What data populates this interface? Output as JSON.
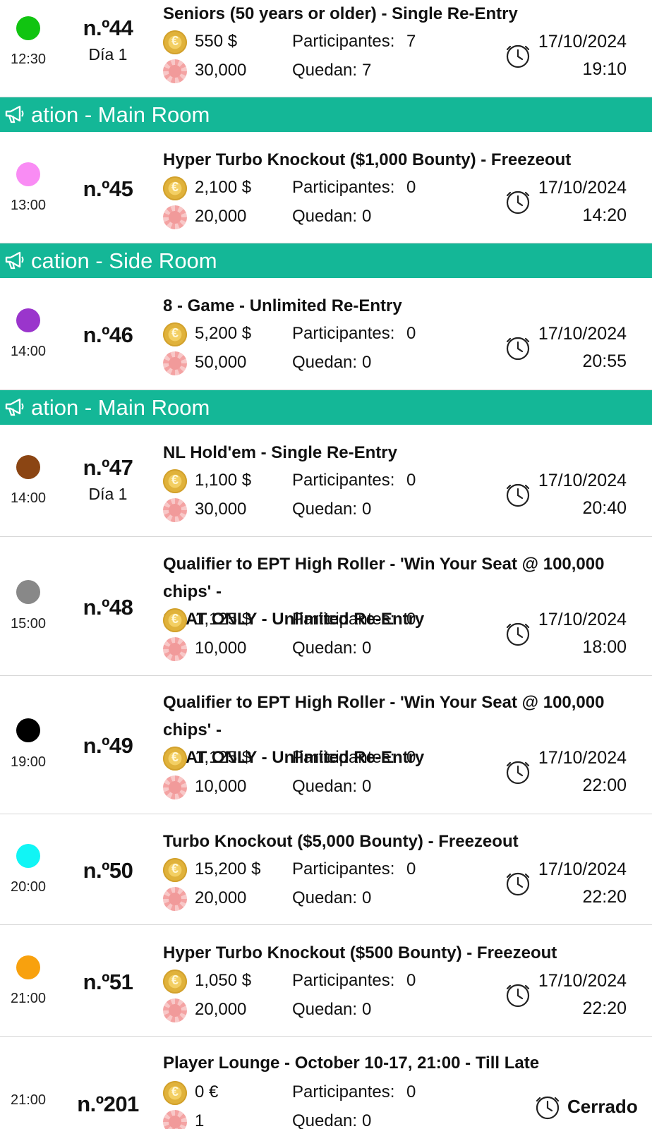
{
  "labels": {
    "participants": "Participantes:",
    "remaining": "Quedan:"
  },
  "rows": [
    {
      "dot_color": "#11c411",
      "time": "12:30",
      "number": "n.º44",
      "day": "Día 1",
      "title": "Seniors (50 years or older) - Single Re-Entry",
      "buyin": "550 $",
      "chips": "30,000",
      "participants": "7",
      "remaining": "7",
      "date": "17/10/2024",
      "end_time": "19:10"
    },
    {
      "banner": "ation - Main Room"
    },
    {
      "dot_color": "#f98cf4",
      "time": "13:00",
      "number": "n.º45",
      "day": "",
      "title": "Hyper Turbo Knockout ($1,000 Bounty) - Freezeout",
      "buyin": "2,100 $",
      "chips": "20,000",
      "participants": "0",
      "remaining": "0",
      "date": "17/10/2024",
      "end_time": "14:20"
    },
    {
      "banner": "cation - Side Room"
    },
    {
      "dot_color": "#9a35cc",
      "time": "14:00",
      "number": "n.º46",
      "day": "",
      "title": "8 - Game - Unlimited Re-Entry",
      "buyin": "5,200 $",
      "chips": "50,000",
      "participants": "0",
      "remaining": "0",
      "date": "17/10/2024",
      "end_time": "20:55"
    },
    {
      "banner": "ation - Main Room"
    },
    {
      "dot_color": "#8b4513",
      "time": "14:00",
      "number": "n.º47",
      "day": "Día 1",
      "title": "NL Hold'em - Single Re-Entry",
      "buyin": "1,100 $",
      "chips": "30,000",
      "participants": "0",
      "remaining": "0",
      "date": "17/10/2024",
      "end_time": "20:40"
    },
    {
      "dot_color": "#888888",
      "time": "15:00",
      "number": "n.º48",
      "day": "",
      "title_line1": "Qualifier to EPT High Roller - 'Win Your Seat @ 100,000 chips' -",
      "title_line2": "SEAT ONLY - Unlimited Re-Entry",
      "buyin": "1,125 $",
      "chips": "10,000",
      "participants": "0",
      "remaining": "0",
      "date": "17/10/2024",
      "end_time": "18:00"
    },
    {
      "dot_color": "#000000",
      "time": "19:00",
      "number": "n.º49",
      "day": "",
      "title_line1": "Qualifier to EPT High Roller - 'Win Your Seat @ 100,000 chips' -",
      "title_line2": "SEAT ONLY - Unlimited Re-Entry",
      "buyin": "1,125 $",
      "chips": "10,000",
      "participants": "0",
      "remaining": "0",
      "date": "17/10/2024",
      "end_time": "22:00"
    },
    {
      "dot_color": "#11f5f5",
      "time": "20:00",
      "number": "n.º50",
      "day": "",
      "title": "Turbo Knockout ($5,000 Bounty) - Freezeout",
      "buyin": "15,200 $",
      "chips": "20,000",
      "participants": "0",
      "remaining": "0",
      "date": "17/10/2024",
      "end_time": "22:20"
    },
    {
      "dot_color": "#f8a10e",
      "time": "21:00",
      "number": "n.º51",
      "day": "",
      "title": "Hyper Turbo Knockout ($500 Bounty) - Freezeout",
      "buyin": "1,050 $",
      "chips": "20,000",
      "participants": "0",
      "remaining": "0",
      "date": "17/10/2024",
      "end_time": "22:20"
    },
    {
      "time": "21:00",
      "number": "n.º201",
      "day": "",
      "title": "Player Lounge - October 10-17, 21:00 - Till Late",
      "buyin": "0 €",
      "chips": "1",
      "participants": "0",
      "remaining": "0",
      "status": "Cerrado"
    }
  ]
}
